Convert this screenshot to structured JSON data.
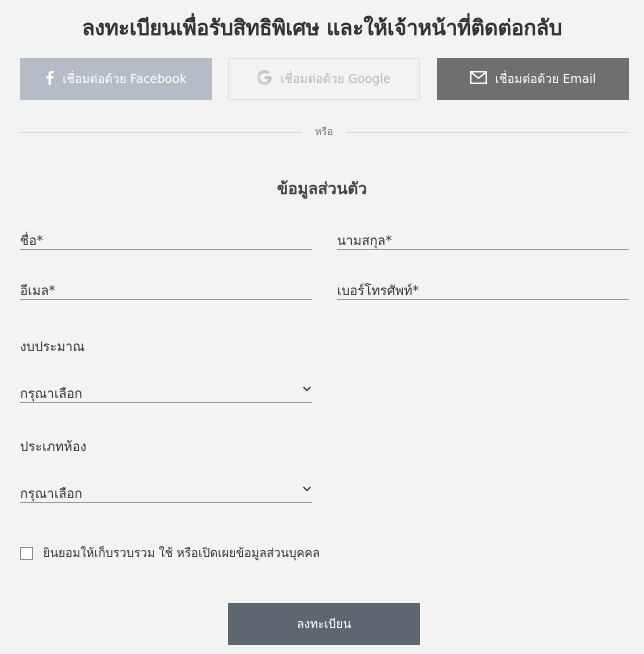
{
  "page": {
    "title": "ลงทะเบียนเพื่อรับสิทธิพิเศษ และให้เจ้าหน้าที่ติดต่อกลับ"
  },
  "social": {
    "facebook_label": "เชื่อมต่อด้วย Facebook",
    "google_label": "เชื่อมต่อด้วย Google",
    "email_label": "เชื่อมต่อด้วย Email"
  },
  "divider": {
    "text": "หรือ"
  },
  "section": {
    "title": "ข้อมูลส่วนตัว"
  },
  "form": {
    "name_placeholder": "ชื่อ*",
    "surname_placeholder": "นามสกุล*",
    "email_placeholder": "อีเมล*",
    "phone_placeholder": "เบอร์โทรศัพท์*",
    "budget_label": "งบประมาณ",
    "budget_value": "กรุณาเลือก",
    "room_label": "ประเภทห้อง",
    "room_value": "กรุณาเลือก",
    "consent_text": "ยินยอมให้เก็บรวบรวม ใช้ หรือเปิดเผยข้อมูลส่วนบุคคล",
    "submit_label": "ลงทะเบียน"
  },
  "icons": {
    "facebook": "facebook-icon",
    "google": "google-icon",
    "email": "mail-icon",
    "chevron": "chevron-down-icon"
  },
  "colors": {
    "facebook_btn": "#b6bcc6",
    "email_btn": "#6f6f6f",
    "submit_btn": "#5e6770"
  }
}
